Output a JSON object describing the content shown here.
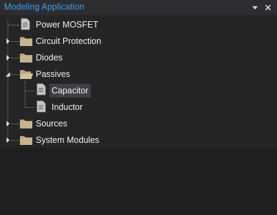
{
  "window": {
    "title": "Modeling Application",
    "menu_icon": "chevron-down-icon",
    "close_icon": "close-icon"
  },
  "colors": {
    "title": "#3b9ee8",
    "panel_bg": "#2d2d30",
    "tree_bg": "#252526",
    "lower_bg": "#1e1e1e",
    "text": "#f1f1f1",
    "selection_bg": "#3f3f46",
    "folder": "#c8b48a"
  },
  "tree": {
    "items": [
      {
        "label": "Power MOSFET",
        "icon": "document-icon",
        "expander": "none",
        "level": 1
      },
      {
        "label": "Circuit Protection",
        "icon": "folder-icon",
        "expander": "collapsed",
        "level": 1
      },
      {
        "label": "Diodes",
        "icon": "folder-icon",
        "expander": "collapsed",
        "level": 1
      },
      {
        "label": "Passives",
        "icon": "folder-open-icon",
        "expander": "expanded",
        "level": 1
      },
      {
        "label": "Capacitor",
        "icon": "document-icon",
        "expander": "none",
        "level": 2,
        "selected": true
      },
      {
        "label": "Inductor",
        "icon": "document-icon",
        "expander": "none",
        "level": 2
      },
      {
        "label": "Sources",
        "icon": "folder-icon",
        "expander": "collapsed",
        "level": 1
      },
      {
        "label": "System Modules",
        "icon": "folder-icon",
        "expander": "collapsed",
        "level": 1
      }
    ]
  }
}
